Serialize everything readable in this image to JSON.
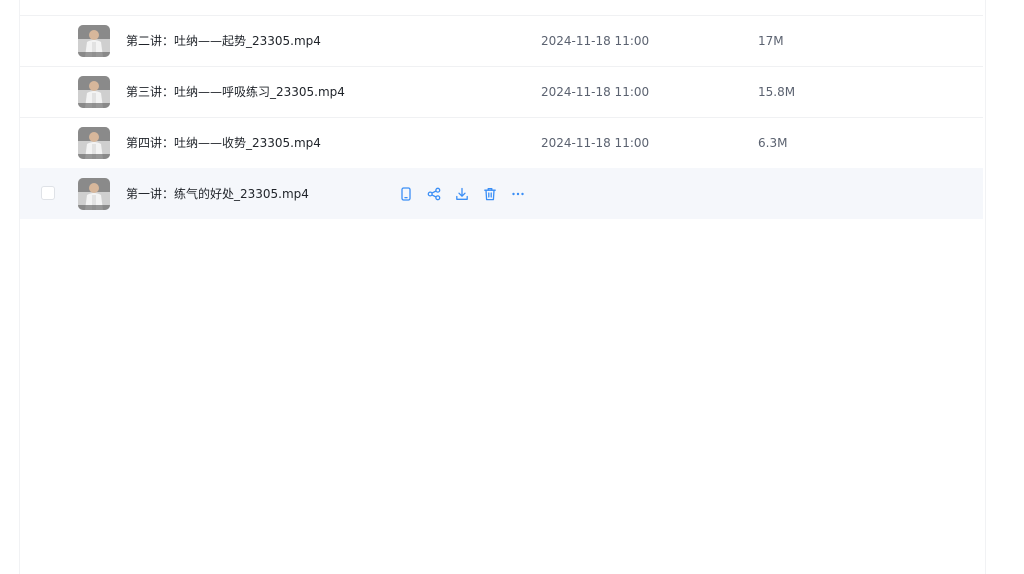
{
  "files": [
    {
      "name": "第二讲：吐纳——起势_23305.mp4",
      "date": "2024-11-18 11:00",
      "size": "17M"
    },
    {
      "name": "第三讲：吐纳——呼吸练习_23305.mp4",
      "date": "2024-11-18 11:00",
      "size": "15.8M"
    },
    {
      "name": "第四讲：吐纳——收势_23305.mp4",
      "date": "2024-11-18 11:00",
      "size": "6.3M"
    },
    {
      "name": "第一讲：练气的好处_23305.mp4",
      "date": "",
      "size": ""
    }
  ],
  "hover_actions": [
    "phone-icon",
    "share-icon",
    "download-icon",
    "delete-icon",
    "more-icon"
  ],
  "colors": {
    "accent": "#3a8ef6",
    "hover_row": "#f5f7fb",
    "text": "#1f2329",
    "meta": "#5b6270"
  }
}
